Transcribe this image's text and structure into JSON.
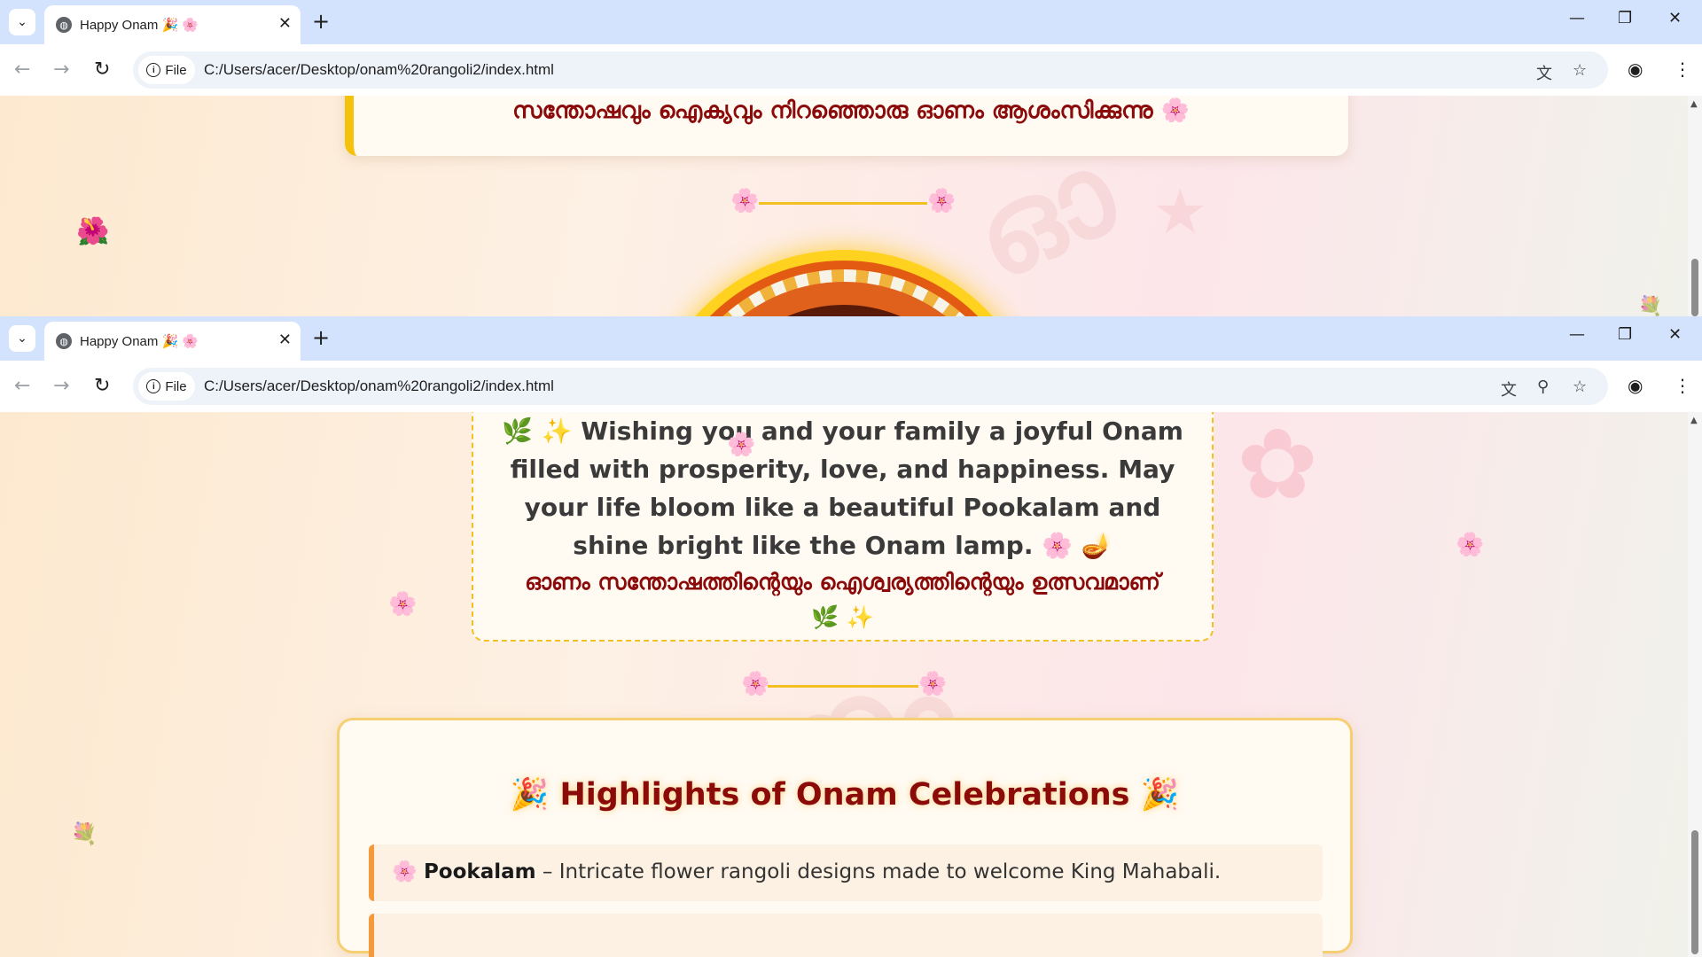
{
  "browser": {
    "tab_title": "Happy Onam 🎉 🌸",
    "tab_close": "✕",
    "new_tab": "+",
    "site_chip": "File",
    "url": "C:/Users/acer/Desktop/onam%20rangoli2/index.html",
    "dropdown_glyph": "⌄",
    "minimize": "—",
    "restore": "❐",
    "close": "✕"
  },
  "top_window": {
    "greeting_ml": "സന്തോഷവും ഐക്യവും നിറഞ്ഞൊരു ഓണം ആശംസിക്കുന്നു 🌸",
    "divider_flower": "🌸",
    "floating_flower": "🌺",
    "corner_flowers": "💐"
  },
  "bottom_window": {
    "wish_en": "🌿 ✨ Wishing you and your family a joyful Onam filled with prosperity, love, and happiness. May your life bloom like a beautiful Pookalam and shine bright like the Onam lamp. 🌸 🪔",
    "wish_ml": "ഓണം സന്തോഷത്തിന്റെയും ഐശ്വര്യത്തിന്റെയും ഉത്സവമാണ് 🌿 ✨",
    "divider_flower": "🌸",
    "highlights_title": "🎉 Highlights of Onam Celebrations 🎉",
    "highlights": [
      {
        "icon": "🌸",
        "name": "Pookalam",
        "desc": " – Intricate flower rangoli designs made to welcome King Mahabali."
      }
    ]
  },
  "colors": {
    "accent_gold": "#f2c023",
    "accent_maroon": "#8b0a0a",
    "tabstrip": "#d3e3fd"
  }
}
